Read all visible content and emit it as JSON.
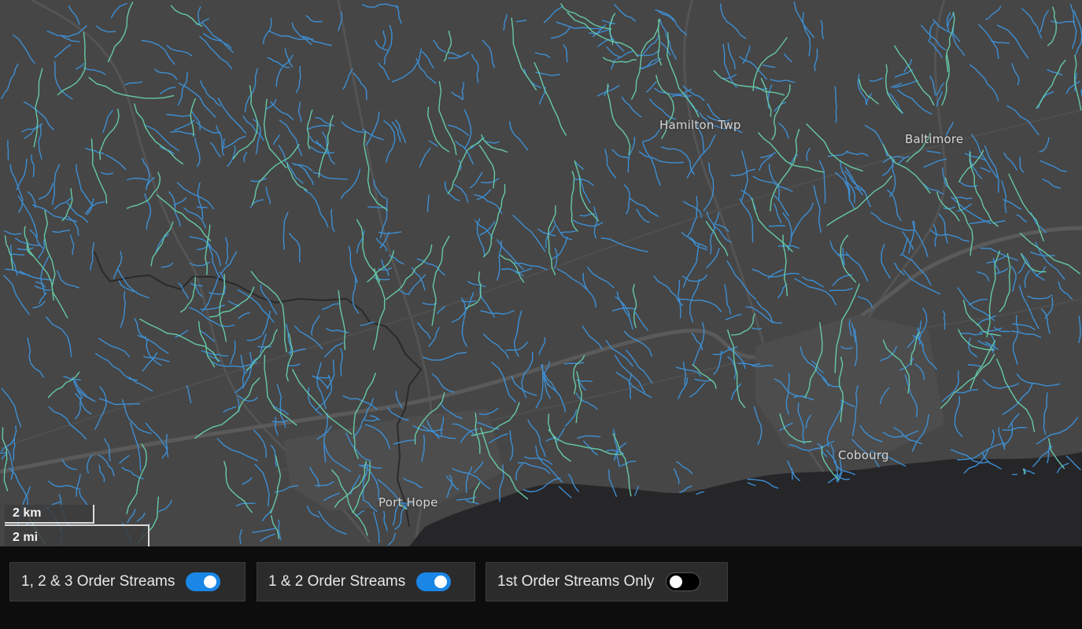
{
  "map": {
    "background": "#464646",
    "water_color": "#262528",
    "stream_colors": {
      "order1": "#3d8fd4",
      "order2": "#66c9a6"
    },
    "places": [
      {
        "name": "Hamilton Twp"
      },
      {
        "name": "Baltimore"
      },
      {
        "name": "Cobourg"
      },
      {
        "name": "Port Hope"
      }
    ],
    "scale": {
      "km_label": "2 km",
      "mi_label": "2 mi"
    }
  },
  "toggles": [
    {
      "label": "1, 2 & 3 Order Streams",
      "on": true
    },
    {
      "label": "1 & 2 Order Streams",
      "on": true
    },
    {
      "label": "1st Order Streams Only",
      "on": false
    }
  ],
  "accent": "#1a86e6"
}
